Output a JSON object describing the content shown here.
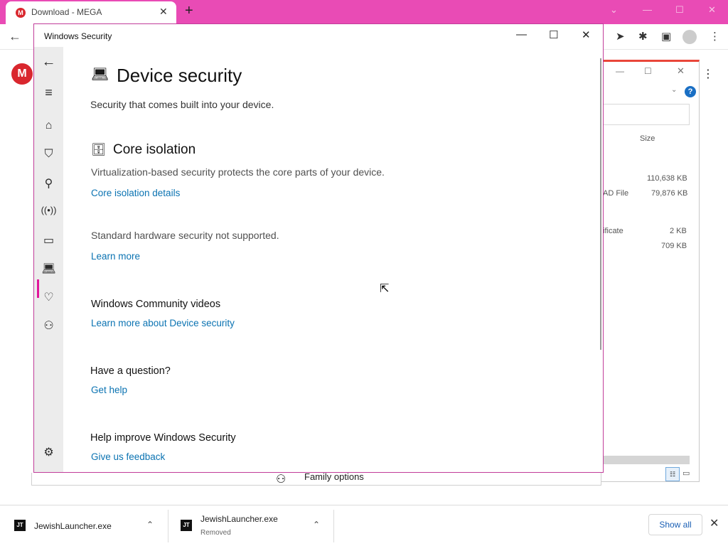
{
  "browser": {
    "tab_title": "Download - MEGA",
    "tab_favicon_letter": "M",
    "close_glyph": "✕",
    "newtab_glyph": "+",
    "logo_letter": "M",
    "download_bar": {
      "items": [
        {
          "name": "JewishLauncher.exe",
          "status": "",
          "icon_label": "JT"
        },
        {
          "name": "JewishLauncher.exe",
          "status": "Removed",
          "icon_label": "JT"
        }
      ],
      "show_all_label": "Show all"
    }
  },
  "explorer": {
    "size_header": "Size",
    "rows": [
      {
        "type": "",
        "size": "110,638 KB"
      },
      {
        "type": "AD File",
        "size": "79,876 KB"
      },
      {
        "type": "ificate",
        "size": "2 KB"
      },
      {
        "type": "",
        "size": "709 KB"
      }
    ],
    "help_glyph": "?"
  },
  "behind_family": {
    "label": "Family options"
  },
  "windows_security": {
    "title": "Windows Security",
    "min_glyph": "—",
    "max_glyph": "☐",
    "close_glyph": "✕",
    "page_title": "Device security",
    "page_subtitle": "Security that comes built into your device.",
    "core": {
      "title": "Core isolation",
      "description": "Virtualization-based security protects the core parts of your device.",
      "details_link": "Core isolation details"
    },
    "hardware": {
      "status": "Standard hardware security not supported.",
      "learn_more": "Learn more"
    },
    "community": {
      "title": "Windows Community videos",
      "link": "Learn more about Device security"
    },
    "question": {
      "title": "Have a question?",
      "link": "Get help"
    },
    "improve": {
      "title": "Help improve Windows Security",
      "link": "Give us feedback"
    }
  },
  "colors": {
    "accent": "#e94bb5",
    "link": "#0b73b2",
    "active_nav": "#e2159c"
  }
}
